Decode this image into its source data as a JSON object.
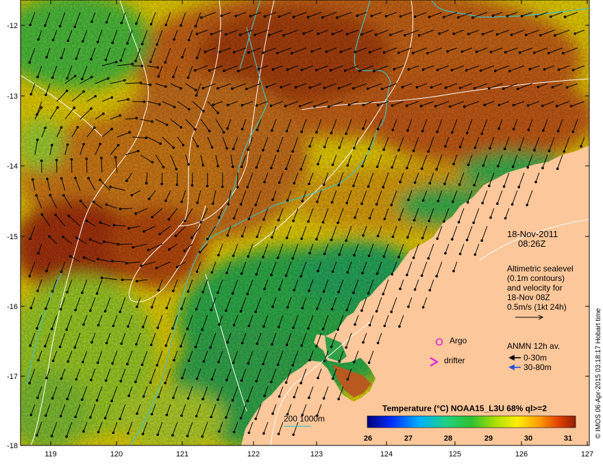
{
  "map": {
    "lon_ticks": [
      "119",
      "120",
      "121",
      "122",
      "123",
      "124",
      "125",
      "126",
      "127"
    ],
    "lat_ticks": [
      "-12",
      "-13",
      "-14",
      "-15",
      "-16",
      "-17",
      "-18"
    ],
    "date": "18-Nov-2011",
    "time": "08:26Z",
    "altimetry_lines": [
      "Altimetric sealevel",
      "(0.1m contours)",
      "and velocity for",
      "18-Nov 08Z",
      "0.5m/s (1kt 24h)"
    ],
    "argo_label": "Argo",
    "drifter_label": "drifter",
    "anmn_title": "ANMN 12h av.",
    "anmn_shallow": "0-30m",
    "anmn_deep": "30-80m",
    "bathy_label": "200  1000m",
    "colorbar_title": "Temperature (°C) NOAA15_L3U 68% ql>=2",
    "colorbar_ticks": [
      "26",
      "27",
      "28",
      "29",
      "30",
      "31"
    ],
    "credit": "© IMOS 06-Apr-2015 03:18:17 Hobart time",
    "colors": {
      "land": "#fcc79a",
      "bathy": "#40c4c4",
      "argo": "#e020e0",
      "anmn_deep": "#2050e0"
    }
  }
}
